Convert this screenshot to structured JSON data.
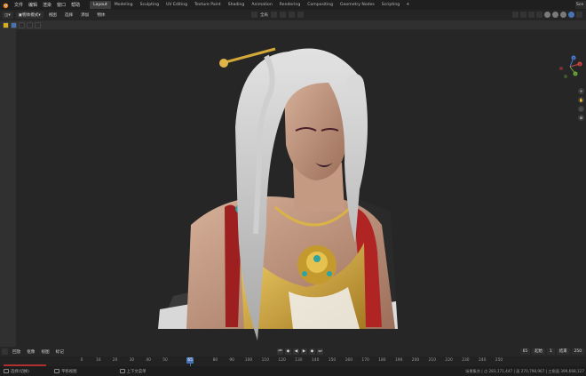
{
  "topbar": {
    "menus": [
      "文件",
      "编辑",
      "渲染",
      "窗口",
      "帮助"
    ],
    "workspaces": [
      "Layout",
      "Modeling",
      "Sculpting",
      "UV Editing",
      "Texture Paint",
      "Shading",
      "Animation",
      "Rendering",
      "Compositing",
      "Geometry Nodes",
      "Scripting"
    ],
    "active_workspace": "Layout",
    "add_tab": "+",
    "scene_label": "Sce"
  },
  "viewport_header": {
    "editor_type": "",
    "mode": "物体模式",
    "menus": [
      "视图",
      "选择",
      "添加",
      "物体"
    ],
    "transform_orientation": "全局",
    "accent": "#4772b3"
  },
  "navigation": {
    "axes": [
      "X",
      "Y",
      "Z"
    ],
    "buttons": [
      "+",
      "✋",
      "🎥",
      "⊞"
    ]
  },
  "timeline": {
    "menus": [
      "回放",
      "抠像",
      "视图",
      "标记"
    ],
    "current_frame": "65",
    "start_label": "起始",
    "start_frame": "1",
    "end_label": "结束",
    "end_frame": "250",
    "current_field": "65",
    "ticks": [
      "0",
      "10",
      "20",
      "30",
      "40",
      "50",
      "60",
      "70",
      "80",
      "90",
      "100",
      "110",
      "120",
      "130",
      "140",
      "150",
      "160",
      "170",
      "180",
      "190",
      "200",
      "210",
      "220",
      "230",
      "240",
      "250"
    ]
  },
  "statusbar": {
    "select": "选择(切换)",
    "rotate": "平移视图",
    "context": "上下文菜单",
    "stats": "场景集合 | 点 283,171,447 | 面 270,798,967 | 三角面 399,668,127"
  },
  "colors": {
    "accent": "#4772b3",
    "playhead": "#4772b3",
    "range": "#b03030",
    "warning": "#d7b018"
  }
}
